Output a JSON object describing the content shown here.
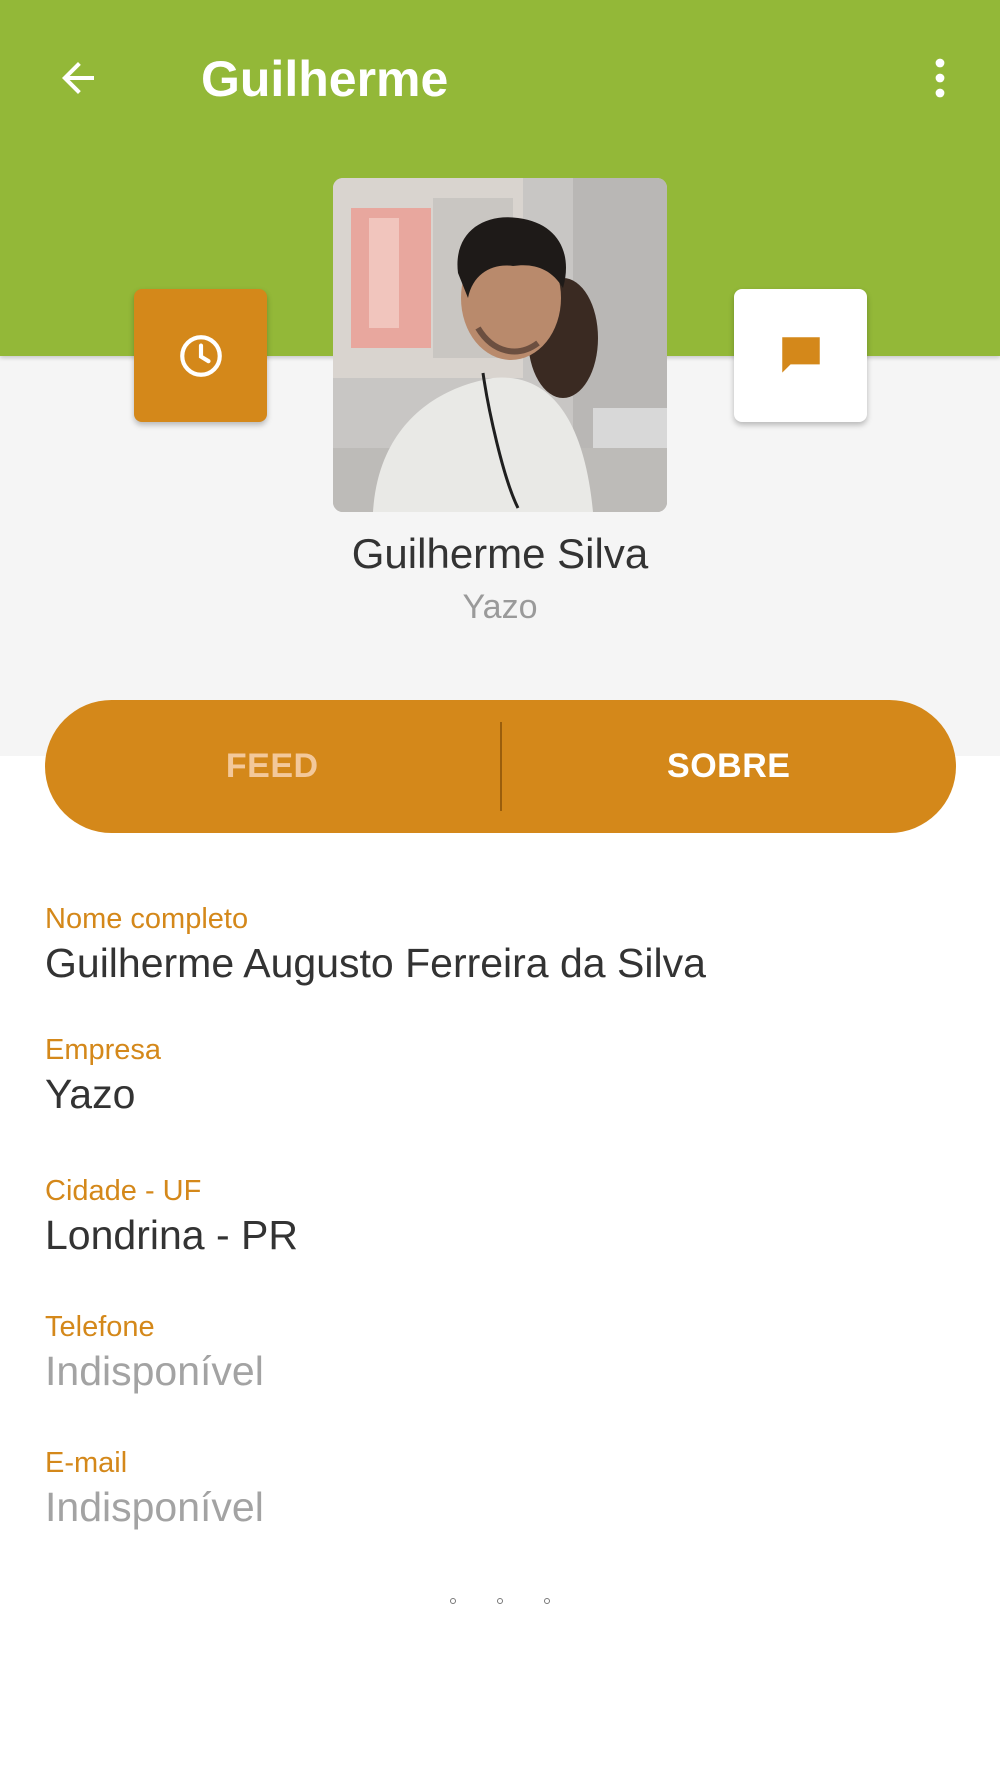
{
  "appbar": {
    "title": "Guilherme",
    "back_icon": "arrow-back-icon",
    "more_icon": "more-vert-icon",
    "background": "#93b838"
  },
  "actions": {
    "history_icon": "clock-icon",
    "message_icon": "chat-bubble-icon",
    "accent": "#d4881a"
  },
  "profile": {
    "name": "Guilherme Silva",
    "company": "Yazo"
  },
  "tabs": [
    {
      "label": "FEED",
      "active": false
    },
    {
      "label": "SOBRE",
      "active": true
    }
  ],
  "about": {
    "fields": [
      {
        "label": "Nome completo",
        "value": "Guilherme Augusto Ferreira da Silva"
      },
      {
        "label": "Empresa",
        "value": "Yazo"
      },
      {
        "label": "Cidade - UF",
        "value": "Londrina - PR"
      },
      {
        "label": "Telefone",
        "value": "Indisponível"
      },
      {
        "label": "E-mail",
        "value": "Indisponível"
      }
    ]
  }
}
